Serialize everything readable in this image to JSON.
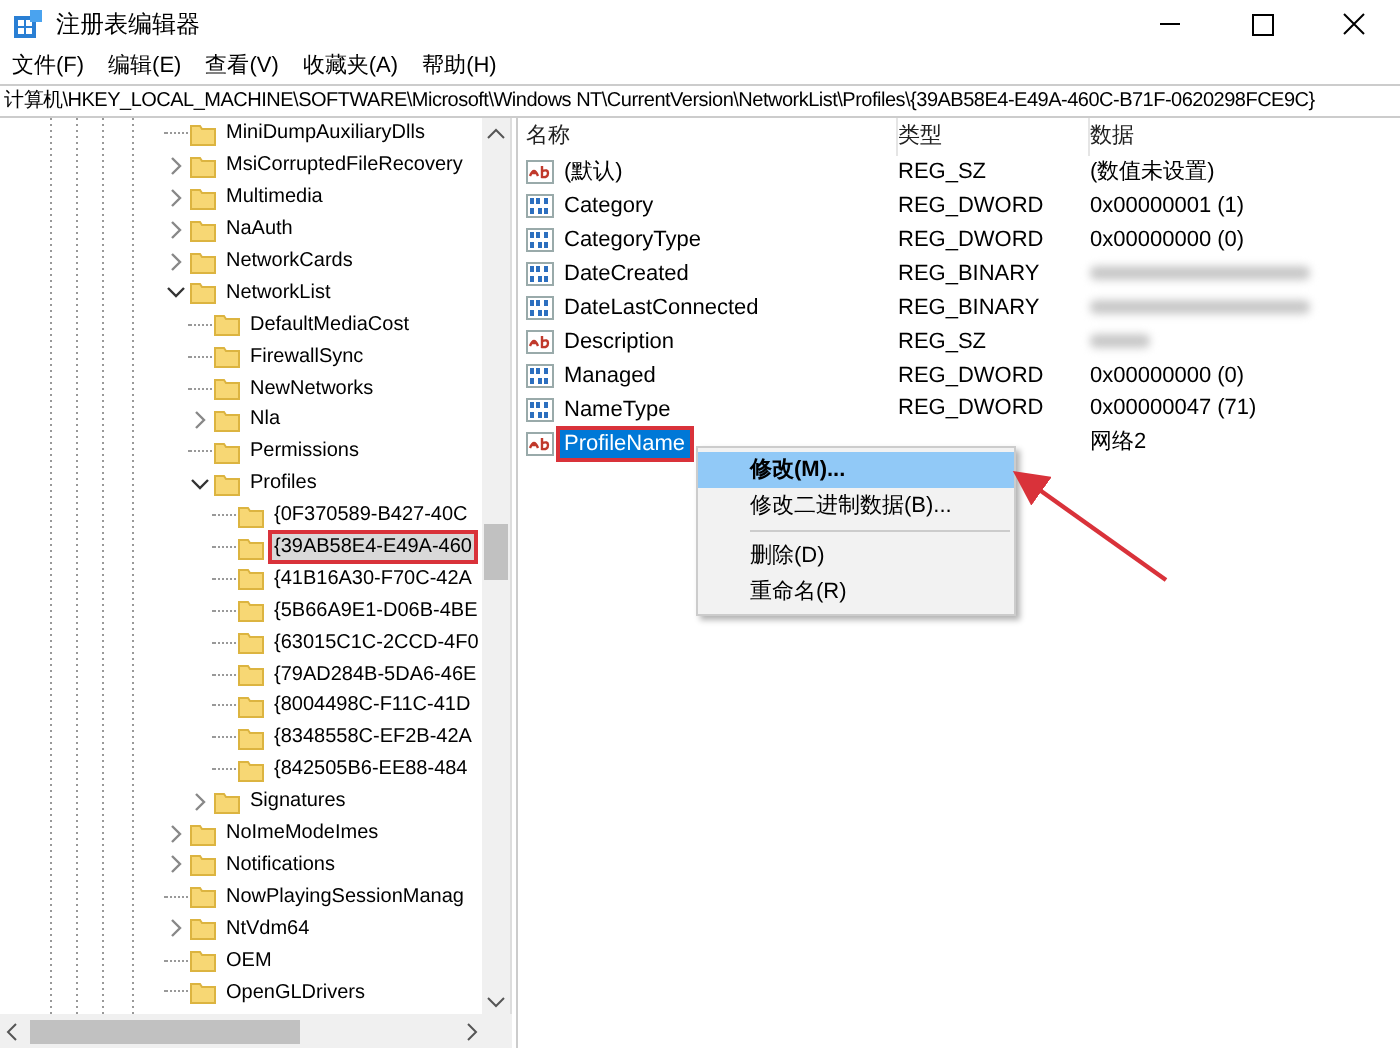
{
  "window": {
    "title": "注册表编辑器"
  },
  "menu": [
    "文件(F)",
    "编辑(E)",
    "查看(V)",
    "收藏夹(A)",
    "帮助(H)"
  ],
  "address": "计算机\\HKEY_LOCAL_MACHINE\\SOFTWARE\\Microsoft\\Windows NT\\CurrentVersion\\NetworkList\\Profiles\\{39AB58E4-E49A-460C-B71F-0620298FCE9C}",
  "tree": [
    {
      "label": "MiniDumpAuxiliaryDlls",
      "kind": "leaf",
      "selected": false
    },
    {
      "label": "MsiCorruptedFileRecovery",
      "kind": "branch",
      "expanded": false,
      "selected": false
    },
    {
      "label": "Multimedia",
      "kind": "branch",
      "expanded": false,
      "selected": false
    },
    {
      "label": "NaAuth",
      "kind": "branch",
      "expanded": false,
      "selected": false
    },
    {
      "label": "NetworkCards",
      "kind": "branch",
      "expanded": false,
      "selected": false
    },
    {
      "label": "NetworkList",
      "kind": "branch",
      "expanded": true,
      "selected": false,
      "children": [
        {
          "label": "DefaultMediaCost",
          "kind": "leaf",
          "selected": false
        },
        {
          "label": "FirewallSync",
          "kind": "leaf",
          "selected": false
        },
        {
          "label": "NewNetworks",
          "kind": "leaf",
          "selected": false
        },
        {
          "label": "Nla",
          "kind": "branch",
          "expanded": false,
          "selected": false
        },
        {
          "label": "Permissions",
          "kind": "leaf",
          "selected": false
        },
        {
          "label": "Profiles",
          "kind": "branch",
          "expanded": true,
          "selected": false,
          "children": [
            {
              "label": "{0F370589-B427-40C",
              "kind": "leaf",
              "selected": false
            },
            {
              "label": "{39AB58E4-E49A-460",
              "kind": "leaf",
              "selected": true,
              "boxed": true
            },
            {
              "label": "{41B16A30-F70C-42A",
              "kind": "leaf",
              "selected": false
            },
            {
              "label": "{5B66A9E1-D06B-4BE",
              "kind": "leaf",
              "selected": false
            },
            {
              "label": "{63015C1C-2CCD-4F0",
              "kind": "leaf",
              "selected": false
            },
            {
              "label": "{79AD284B-5DA6-46E",
              "kind": "leaf",
              "selected": false
            },
            {
              "label": "{8004498C-F11C-41D",
              "kind": "leaf",
              "selected": false
            },
            {
              "label": "{8348558C-EF2B-42A",
              "kind": "leaf",
              "selected": false
            },
            {
              "label": "{842505B6-EE88-484",
              "kind": "leaf",
              "selected": false
            }
          ]
        },
        {
          "label": "Signatures",
          "kind": "branch",
          "expanded": false,
          "selected": false
        }
      ]
    },
    {
      "label": "NoImeModeImes",
      "kind": "branch",
      "expanded": false,
      "selected": false
    },
    {
      "label": "Notifications",
      "kind": "branch",
      "expanded": false,
      "selected": false
    },
    {
      "label": "NowPlayingSessionManag",
      "kind": "leaf",
      "selected": false
    },
    {
      "label": "NtVdm64",
      "kind": "branch",
      "expanded": false,
      "selected": false
    },
    {
      "label": "OEM",
      "kind": "leaf",
      "selected": false
    },
    {
      "label": "OpenGLDrivers",
      "kind": "leaf",
      "selected": false
    }
  ],
  "values": {
    "columns": [
      "名称",
      "类型",
      "数据"
    ],
    "rows": [
      {
        "kind": "string",
        "name": "(默认)",
        "type": "REG_SZ",
        "data": "(数值未设置)",
        "redacted": false,
        "selected": false
      },
      {
        "kind": "binary",
        "name": "Category",
        "type": "REG_DWORD",
        "data": "0x00000001 (1)",
        "redacted": false,
        "selected": false
      },
      {
        "kind": "binary",
        "name": "CategoryType",
        "type": "REG_DWORD",
        "data": "0x00000000 (0)",
        "redacted": false,
        "selected": false
      },
      {
        "kind": "binary",
        "name": "DateCreated",
        "type": "REG_BINARY",
        "redacted": true,
        "selected": false
      },
      {
        "kind": "binary",
        "name": "DateLastConnected",
        "type": "REG_BINARY",
        "redacted": true,
        "selected": false
      },
      {
        "kind": "string",
        "name": "Description",
        "type": "REG_SZ",
        "redacted": true,
        "selected": false
      },
      {
        "kind": "binary",
        "name": "Managed",
        "type": "REG_DWORD",
        "data": "0x00000000 (0)",
        "redacted": false,
        "selected": false
      },
      {
        "kind": "binary",
        "name": "NameType",
        "type": "REG_DWORD",
        "data": "0x00000047 (71)",
        "redacted": false,
        "selected": false
      },
      {
        "kind": "string",
        "name": "ProfileName",
        "data": "网络2",
        "redacted": false,
        "selected": true,
        "boxed": true
      }
    ]
  },
  "context_menu": [
    {
      "kind": "item",
      "label": "修改(M)...",
      "default": true,
      "selected": true
    },
    {
      "kind": "item",
      "label": "修改二进制数据(B)...",
      "default": false,
      "selected": false
    },
    {
      "kind": "separator"
    },
    {
      "kind": "item",
      "label": "删除(D)",
      "default": false,
      "selected": false
    },
    {
      "kind": "item",
      "label": "重命名(R)",
      "default": false,
      "selected": false
    }
  ]
}
